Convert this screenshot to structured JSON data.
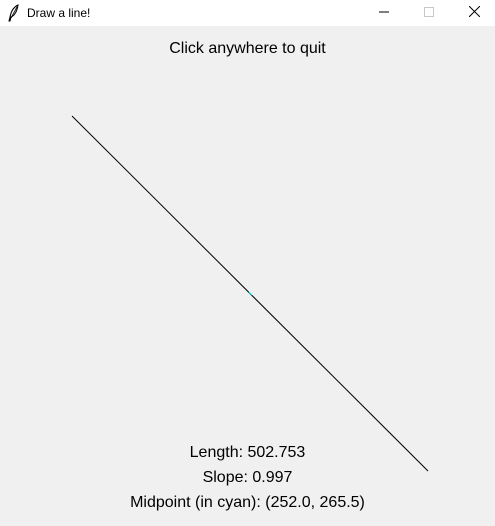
{
  "window": {
    "title": "Draw a line!",
    "icon": "feather-icon",
    "controls": [
      "minimize-icon",
      "maximize-icon",
      "close-icon"
    ]
  },
  "canvas": {
    "instruction": "Click anywhere to quit",
    "line_color": "#000000",
    "midpoint_color": "#00ffff",
    "length_text": "Length: 502.753",
    "slope_text": "Slope: 0.997",
    "midpoint_text": "Midpoint (in cyan): (252.0, 265.5)"
  }
}
